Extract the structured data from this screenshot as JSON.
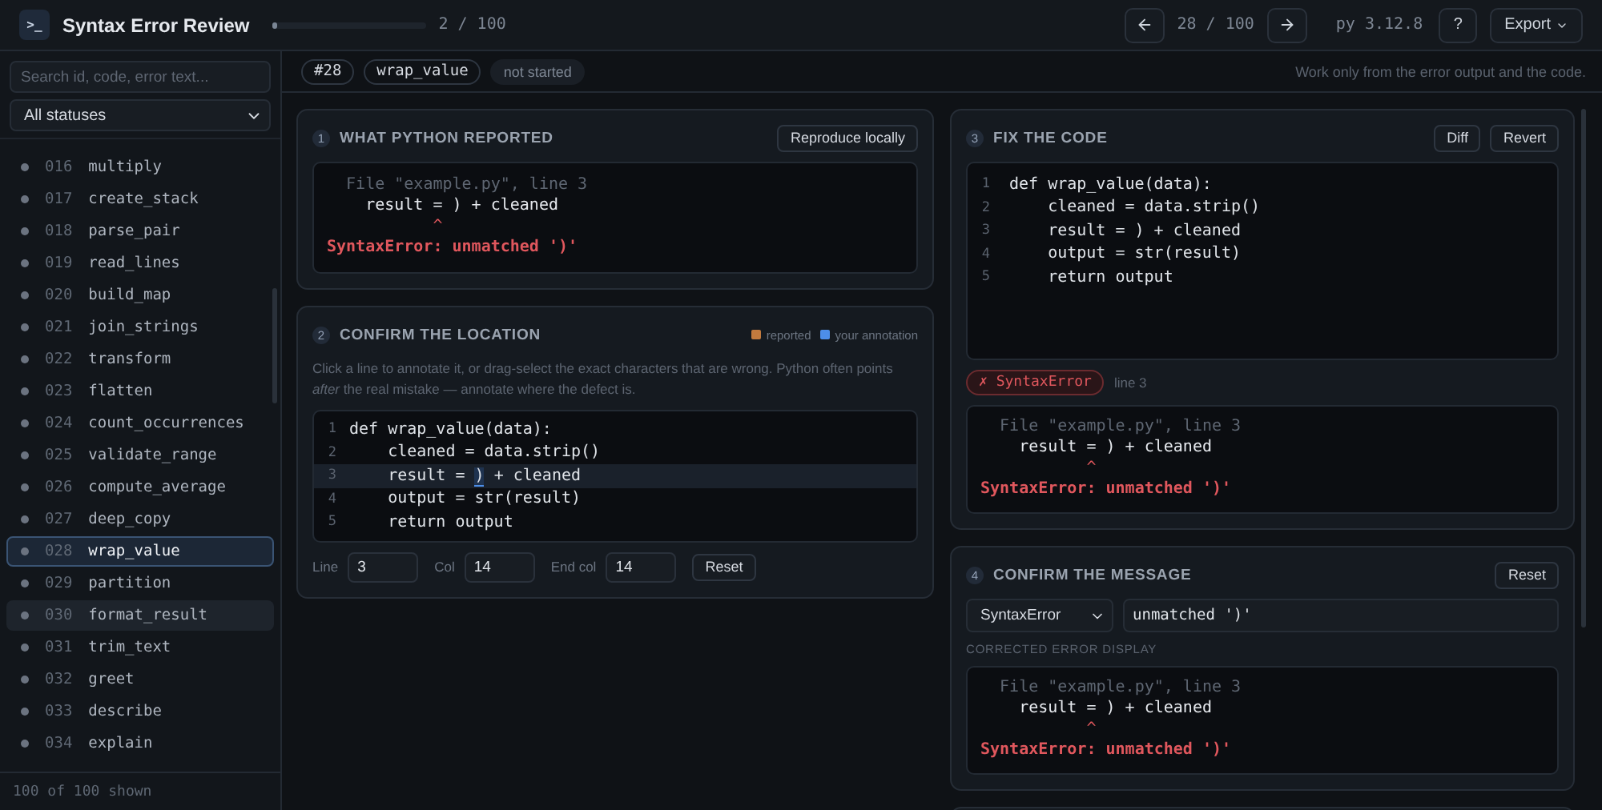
{
  "header": {
    "logo": ">_",
    "title": "Syntax Error Review",
    "progress": {
      "level": 0.02,
      "label": "2 / 100"
    },
    "counter": "28 / 100",
    "python_version": "py 3.12.8",
    "help": "?",
    "export": "Export"
  },
  "sidebar": {
    "search_placeholder": "Search id, code, error text...",
    "status_filter": "All statuses",
    "items": [
      {
        "id": "016",
        "name": "multiply",
        "selected": false,
        "hovered": false
      },
      {
        "id": "017",
        "name": "create_stack",
        "selected": false,
        "hovered": false
      },
      {
        "id": "018",
        "name": "parse_pair",
        "selected": false,
        "hovered": false
      },
      {
        "id": "019",
        "name": "read_lines",
        "selected": false,
        "hovered": false
      },
      {
        "id": "020",
        "name": "build_map",
        "selected": false,
        "hovered": false
      },
      {
        "id": "021",
        "name": "join_strings",
        "selected": false,
        "hovered": false
      },
      {
        "id": "022",
        "name": "transform",
        "selected": false,
        "hovered": false
      },
      {
        "id": "023",
        "name": "flatten",
        "selected": false,
        "hovered": false
      },
      {
        "id": "024",
        "name": "count_occurrences",
        "selected": false,
        "hovered": false
      },
      {
        "id": "025",
        "name": "validate_range",
        "selected": false,
        "hovered": false
      },
      {
        "id": "026",
        "name": "compute_average",
        "selected": false,
        "hovered": false
      },
      {
        "id": "027",
        "name": "deep_copy",
        "selected": false,
        "hovered": false
      },
      {
        "id": "028",
        "name": "wrap_value",
        "selected": true,
        "hovered": false
      },
      {
        "id": "029",
        "name": "partition",
        "selected": false,
        "hovered": false
      },
      {
        "id": "030",
        "name": "format_result",
        "selected": false,
        "hovered": true
      },
      {
        "id": "031",
        "name": "trim_text",
        "selected": false,
        "hovered": false
      },
      {
        "id": "032",
        "name": "greet",
        "selected": false,
        "hovered": false
      },
      {
        "id": "033",
        "name": "describe",
        "selected": false,
        "hovered": false
      },
      {
        "id": "034",
        "name": "explain",
        "selected": false,
        "hovered": false
      }
    ],
    "footer": "100 of 100 shown"
  },
  "task": {
    "id": "#28",
    "name": "wrap_value",
    "status": "not started",
    "hint": "Work only from the error output and the code."
  },
  "reported": {
    "number": "1",
    "title": "WHAT PYTHON REPORTED",
    "button": "Reproduce locally",
    "traceback": {
      "file_line": "  File \"example.py\", line 3",
      "code_line": "    result = ) + cleaned",
      "caret": "           ^",
      "error": "SyntaxError: unmatched ')'"
    }
  },
  "location": {
    "number": "2",
    "title": "CONFIRM THE LOCATION",
    "legend": [
      {
        "kind": "reported",
        "label": "reported"
      },
      {
        "kind": "annotation",
        "label": "your annotation"
      }
    ],
    "instructions": "Click a line to annotate it, or drag-select the exact characters that are wrong. Python often points *after* the real mistake — annotate where the defect is.",
    "lines": [
      {
        "number": "1",
        "selected": false,
        "text": "def wrap_value(data):"
      },
      {
        "number": "2",
        "selected": false,
        "text": "    cleaned = data.strip()"
      },
      {
        "number": "3",
        "selected": true,
        "annotation": {
          "before": "    result = ",
          "mark": ")",
          "after": " + cleaned"
        }
      },
      {
        "number": "4",
        "selected": false,
        "text": "    output = str(result)"
      },
      {
        "number": "5",
        "selected": false,
        "text": "    return output"
      }
    ],
    "fields": [
      {
        "label": "Line",
        "value": "3"
      },
      {
        "label": "Col",
        "value": "14"
      },
      {
        "label": "End col",
        "value": "14"
      }
    ],
    "reset": "Reset"
  },
  "fix": {
    "number": "3",
    "title": "FIX THE CODE",
    "buttons": [
      "Diff",
      "Revert"
    ],
    "lines": [
      {
        "number": "1",
        "text": "def wrap_value(data):"
      },
      {
        "number": "2",
        "text": "    cleaned = data.strip()"
      },
      {
        "number": "3",
        "text": "    result = ) + cleaned"
      },
      {
        "number": "4",
        "text": "    output = str(result)"
      },
      {
        "number": "5",
        "text": "    return output"
      }
    ],
    "result": {
      "kind": "error",
      "mark": "✗",
      "label": "SyntaxError",
      "detail": "line 3"
    },
    "traceback": {
      "file_line": "  File \"example.py\", line 3",
      "code_line": "    result = ) + cleaned",
      "caret": "           ^",
      "error": "SyntaxError: unmatched ')'"
    }
  },
  "message": {
    "number": "4",
    "title": "CONFIRM THE MESSAGE",
    "reset": "Reset",
    "error_type": "SyntaxError",
    "message": "unmatched ')'",
    "caption": "CORRECTED ERROR DISPLAY",
    "traceback": {
      "file_line": "  File \"example.py\", line 3",
      "code_line": "    result = ) + cleaned",
      "caret": "           ^",
      "error": "SyntaxError: unmatched ')'"
    }
  }
}
